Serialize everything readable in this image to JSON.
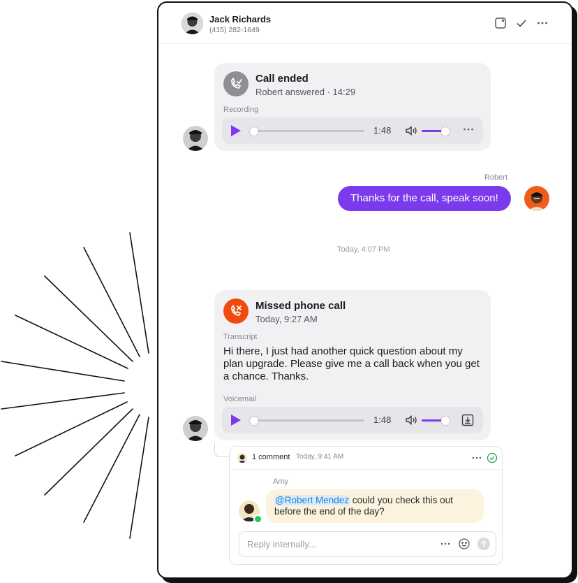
{
  "contact": {
    "name": "Jack Richards",
    "phone": "(415) 282-1649"
  },
  "header_actions": [
    "note-icon",
    "check-icon",
    "more-icon"
  ],
  "call_ended": {
    "title": "Call ended",
    "subtitle": "Robert answered · 14:29",
    "recording_label": "Recording",
    "player": {
      "time": "1:48",
      "progress": 0.0,
      "volume": 0.8
    }
  },
  "outgoing": {
    "sender": "Robert",
    "text": "Thanks for the call, speak soon!"
  },
  "divider_timestamp": "Today, 4:07 PM",
  "missed_call": {
    "title": "Missed phone call",
    "subtitle": "Today, 9:27 AM",
    "transcript_label": "Transcript",
    "transcript": "Hi there, I just had another quick question about my plan upgrade. Please give me a call back when you get a chance. Thanks.",
    "voicemail_label": "Voicemail",
    "player": {
      "time": "1:48",
      "progress": 0.0,
      "volume": 0.8
    }
  },
  "comment_thread": {
    "count_label": "1 comment",
    "time": "Today, 9:41 AM",
    "author": "Amy",
    "mention": "@Robert Mendez",
    "text": " could you check this out before the end of the day?",
    "reply_placeholder": "Reply internally..."
  },
  "colors": {
    "accent": "#7c3aed",
    "missed": "#f2490c",
    "ended": "#8e8e96",
    "comment_bg": "#fbf3dd",
    "online": "#22c55e"
  }
}
